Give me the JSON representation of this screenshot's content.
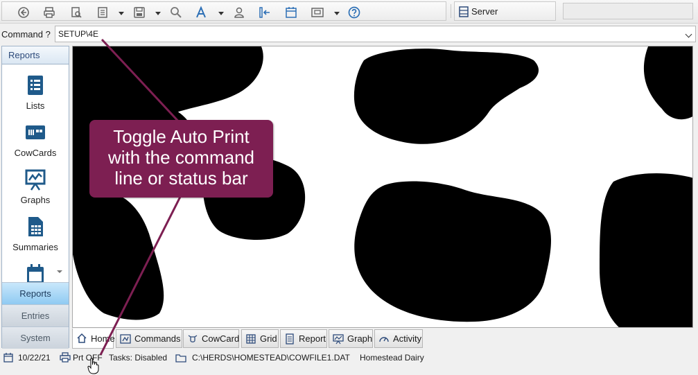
{
  "toolbar": {
    "server_label": "Server",
    "search_placeholder": ""
  },
  "command": {
    "label": "Command ?",
    "value": "SETUP\\4E"
  },
  "nav": {
    "title": "Reports",
    "items": [
      {
        "label": "Lists",
        "icon": "list-icon"
      },
      {
        "label": "CowCards",
        "icon": "cowcard-icon"
      },
      {
        "label": "Graphs",
        "icon": "graph-icon"
      },
      {
        "label": "Summaries",
        "icon": "summary-icon"
      },
      {
        "label": "",
        "icon": "calendar-report-icon"
      }
    ],
    "sections": [
      {
        "label": "Reports",
        "active": true
      },
      {
        "label": "Entries",
        "active": false
      },
      {
        "label": "System",
        "active": false
      }
    ]
  },
  "tabs": [
    {
      "label": "Home",
      "icon": "home-icon",
      "active": true
    },
    {
      "label": "Commands",
      "icon": "commands-icon",
      "active": false
    },
    {
      "label": "CowCard",
      "icon": "cow-icon",
      "active": false
    },
    {
      "label": "Grid",
      "icon": "grid-icon",
      "active": false
    },
    {
      "label": "Report",
      "icon": "report-icon",
      "active": false
    },
    {
      "label": "Graph",
      "icon": "graph-icon",
      "active": false
    },
    {
      "label": "Activity",
      "icon": "gauge-icon",
      "active": false
    }
  ],
  "status": {
    "date": "10/22/21",
    "printer": "Prt OFF",
    "tasks": "Tasks: Disabled",
    "file": "C:\\HERDS\\HOMESTEAD\\COWFILE1.DAT",
    "herd": "Homestead Dairy"
  },
  "callout": {
    "line1": "Toggle Auto Print",
    "line2": "with the command",
    "line3": "line or status bar"
  },
  "colors": {
    "callout": "#7d1f52",
    "accent_blue": "#2c6fb5",
    "active_tab": "#8fcaf2"
  }
}
